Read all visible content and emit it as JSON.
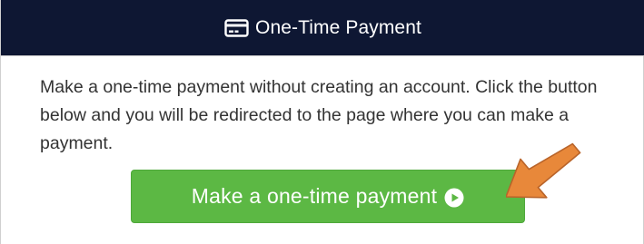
{
  "header": {
    "icon": "credit-card-icon",
    "title": "One-Time Payment"
  },
  "body": {
    "description": "Make a one-time payment without creating an account. Click the button below and you will be redirected to the page where you can make a payment."
  },
  "payment_button": {
    "label": "Make a one-time payment",
    "icon": "play-circle-icon"
  },
  "annotation": {
    "icon": "arrow-pointer-icon",
    "color": "#e8883a"
  },
  "colors": {
    "header_bg": "#0e1733",
    "button_bg": "#5cb844",
    "arrow": "#e8883a"
  }
}
